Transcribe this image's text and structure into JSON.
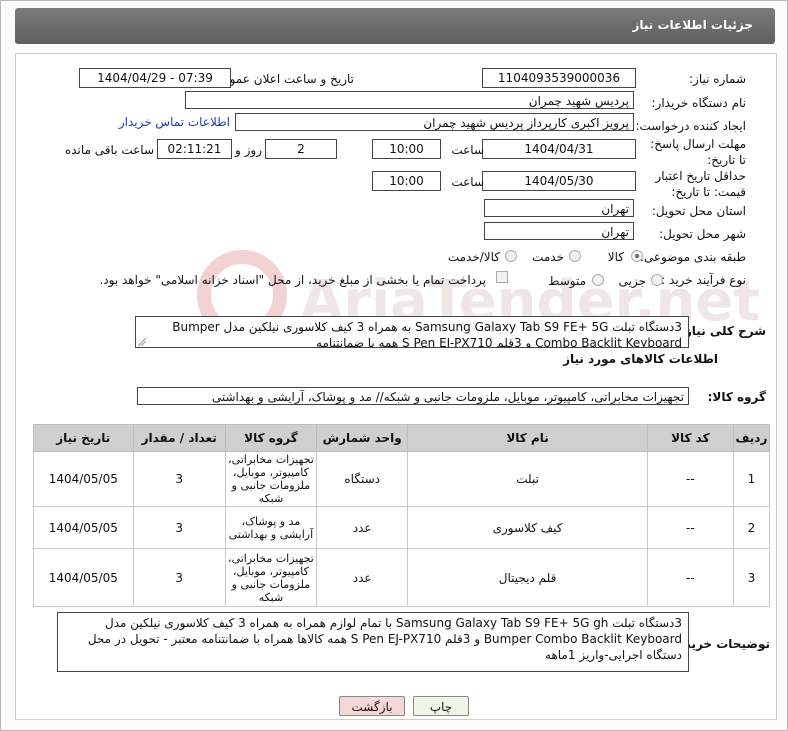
{
  "header": {
    "title": "جزئیات اطلاعات نیاز"
  },
  "fields": {
    "need_number_label": "شماره نیاز:",
    "need_number": "1104093539000036",
    "announce_label": "تاریخ و ساعت اعلان عمومی:",
    "announce_value": "1404/04/29 - 07:39",
    "buyer_org_label": "نام دستگاه خریدار:",
    "buyer_org": "پردیس شهید چمران",
    "requester_label": "ایجاد کننده درخواست:",
    "requester": "پرویز اکبری کارپرداز پردیس شهید چمران",
    "contact_link": "اطلاعات تماس خریدار",
    "deadline_label": "مهلت ارسال پاسخ: تا تاریخ:",
    "deadline_date": "1404/04/31",
    "time_label": "ساعت",
    "deadline_time": "10:00",
    "days_value": "2",
    "days_label": "روز و",
    "remaining_value": "02:11:21",
    "remaining_label": "ساعت باقی مانده",
    "validity_label": "حداقل تاریخ اعتبار قیمت: تا تاریخ:",
    "validity_date": "1404/05/30",
    "validity_time": "10:00",
    "province_label": "استان محل تحویل:",
    "province": "تهران",
    "city_label": "شهر محل تحویل:",
    "city": "تهران",
    "category_label": "طبقه بندی موضوعی:",
    "category_options": [
      "کالا",
      "خدمت",
      "کالا/خدمت"
    ],
    "process_label": "نوع فرآیند خرید :",
    "process_options": [
      "جزیی",
      "متوسط"
    ],
    "payment_note": "پرداخت تمام یا بخشی از مبلغ خرید، از محل \"اسناد خزانه اسلامی\" خواهد بود."
  },
  "summary": {
    "label": "شرح کلی نیاز:",
    "text": "3دستگاه تبلت Samsung Galaxy Tab S9 FE+ 5G به همراه 3 کیف کلاسوری نیلکین مدل Bumper Combo Backlit Keyboard و 3قلم S Pen EJ-PX710 همه با ضمانتنامه"
  },
  "goods": {
    "section_title": "اطلاعات کالاهای مورد نیاز",
    "group_label": "گروه کالا:",
    "group_value": "تجهیزات مخابراتی، کامپیوتر، موبایل، ملزومات جانبی و شبکه// مد و پوشاک، آرایشی و بهداشتی",
    "columns": [
      "ردیف",
      "کد کالا",
      "نام کالا",
      "واحد شمارش",
      "گروه کالا",
      "تعداد / مقدار",
      "تاریخ نیاز"
    ],
    "rows": [
      {
        "idx": "1",
        "code": "--",
        "name": "تبلت",
        "unit": "دستگاه",
        "group": "تجهیزات مخابراتی، کامپیوتر، موبایل، ملزومات جانبی و شبکه",
        "qty": "3",
        "date": "1404/05/05"
      },
      {
        "idx": "2",
        "code": "--",
        "name": "کیف کلاسوری",
        "unit": "عدد",
        "group": "مد و پوشاک، آرایشی و بهداشتی",
        "qty": "3",
        "date": "1404/05/05"
      },
      {
        "idx": "3",
        "code": "--",
        "name": "قلم دیجیتال",
        "unit": "عدد",
        "group": "تجهیزات مخابراتی، کامپیوتر، موبایل، ملزومات جانبی و شبکه",
        "qty": "3",
        "date": "1404/05/05"
      }
    ]
  },
  "buyer_notes": {
    "label": "توضیحات خریدار:",
    "text": "3دستگاه تبلت Samsung Galaxy Tab S9 FE+ 5G gh با تمام لوازم همراه به همراه 3 کیف کلاسوری نیلکین مدل Bumper Combo Backlit Keyboard و 3قلم S Pen EJ-PX710 همه کالاها همراه با ضمانتنامه معتبر - تحویل در محل دستگاه اجرایی-واریز 1ماهه"
  },
  "buttons": {
    "print": "چاپ",
    "back": "بازگشت"
  },
  "watermark": "AriaTender.net",
  "colors": {
    "header_bg": "#6b6b6b",
    "link": "#1a3fb0",
    "back_btn_bg": "#f6d7d7",
    "print_btn_bg": "#eef6e8"
  }
}
